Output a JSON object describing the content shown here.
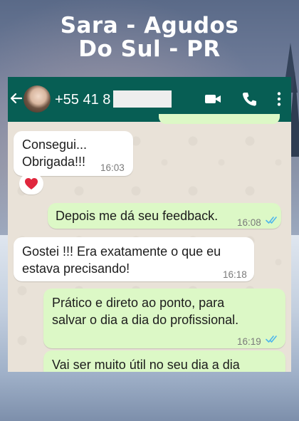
{
  "headline": {
    "line1": "Sara - Agudos",
    "line2": "Do Sul - PR"
  },
  "chat_header": {
    "contact_number": "+55 41 8",
    "icons": [
      "back-arrow-icon",
      "avatar",
      "video-call-icon",
      "voice-call-icon",
      "more-options-icon"
    ]
  },
  "messages": [
    {
      "direction": "incoming",
      "text_line1": "Consegui...",
      "text_line2": "Obrigada!!!",
      "time": "16:03",
      "reaction": "❤️"
    },
    {
      "direction": "outgoing",
      "text_line1": "Depois me dá seu feedback.",
      "time": "16:08",
      "status": "read"
    },
    {
      "direction": "incoming",
      "text_line1": "Gostei !!! Era exatamente o que eu",
      "text_line2": "estava precisando!",
      "time": "16:18"
    },
    {
      "direction": "outgoing",
      "text_line1": "Prático e direto ao ponto, para",
      "text_line2": "salvar o dia a dia do profissional.",
      "time": "16:19",
      "status": "read"
    },
    {
      "direction": "outgoing",
      "text_line1": "Vai ser muito útil no seu dia a dia"
    }
  ],
  "colors": {
    "header": "#075e54",
    "outgoing_bubble": "#dcf8c6",
    "incoming_bubble": "#ffffff",
    "read_ticks": "#4fb6ec"
  }
}
